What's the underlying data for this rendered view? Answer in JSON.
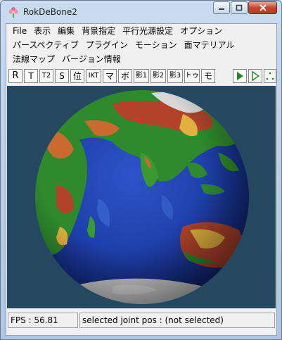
{
  "window": {
    "title": "RokDeBone2"
  },
  "menu": {
    "row1": [
      "File",
      "表示",
      "編集",
      "背景指定",
      "平行光源設定",
      "オプション"
    ],
    "row2": [
      "パースペクティブ",
      "プラグイン",
      "モーション",
      "面マテリアル"
    ],
    "row3": [
      "法線マップ",
      "バージョン情報"
    ]
  },
  "toolbar": {
    "buttons": [
      "R",
      "T",
      "T2",
      "S",
      "位",
      "IKT",
      "マ",
      "ボ",
      "影1",
      "影2",
      "影3",
      "トゥ",
      "モ"
    ]
  },
  "status": {
    "fps": "FPS : 56.81",
    "selection": "selected joint pos : (not selected)"
  },
  "colors": {
    "viewport_bg": "#244860",
    "ocean": "#1d3ea8",
    "land_green": "#2f8a2c",
    "land_brown": "#b0432a"
  }
}
